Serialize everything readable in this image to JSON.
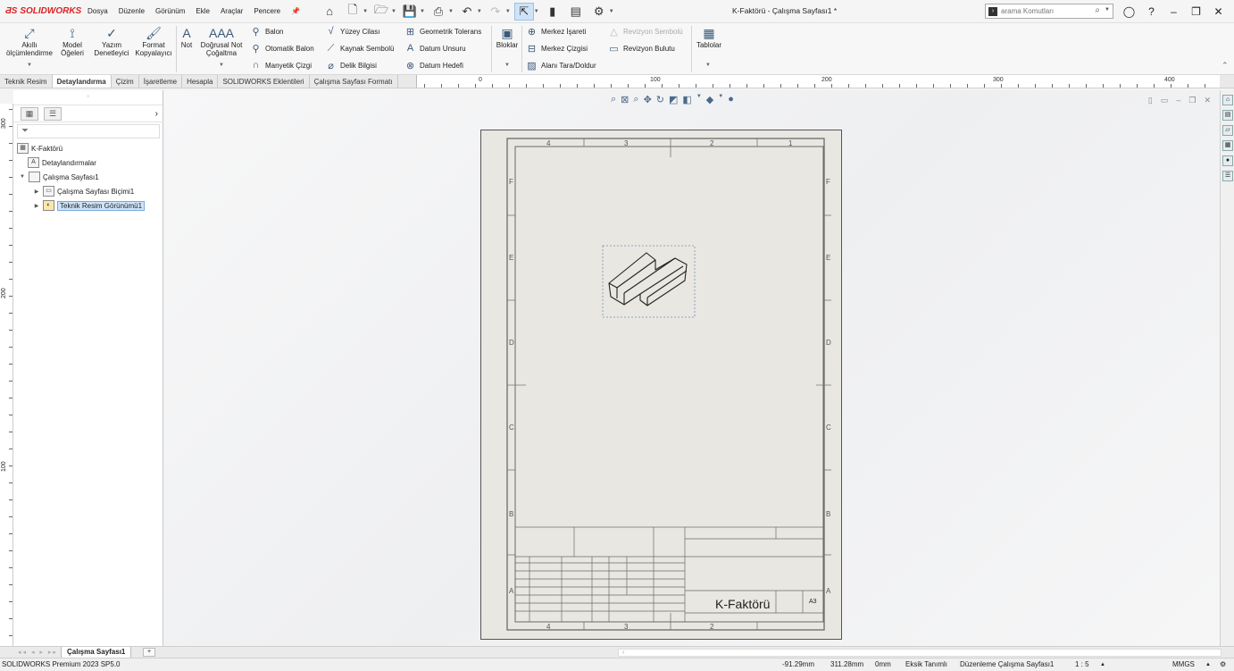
{
  "app": {
    "logo_text": "SOLIDWORKS",
    "window_title": "K-Faktörü - Çalışma Sayfası1 *"
  },
  "menu": [
    "Dosya",
    "Düzenle",
    "Görünüm",
    "Ekle",
    "Araçlar",
    "Pencere"
  ],
  "search": {
    "placeholder": "arama Komutları"
  },
  "ribbon": {
    "big_buttons": [
      {
        "label": "Akıllı ölçümlendirme",
        "icon": "smart-dimension-icon"
      },
      {
        "label": "Model Öğeleri",
        "icon": "model-items-icon"
      },
      {
        "label": "Yazım Denetleyici",
        "icon": "spell-checker-icon"
      },
      {
        "label": "Format Kopyalayıcı",
        "icon": "format-painter-icon"
      },
      {
        "label": "Not",
        "icon": "note-icon"
      },
      {
        "label": "Doğrusal Not Çoğaltma",
        "icon": "linear-note-pattern-icon"
      }
    ],
    "col1": [
      "Balon",
      "Otomatik Balon",
      "Manyetik Çizgi"
    ],
    "col2": [
      "Yüzey Cilası",
      "Kaynak Sembolü",
      "Delik Bilgisi"
    ],
    "col3": [
      "Geometrik Tolerans",
      "Datum Unsuru",
      "Datum Hedefi"
    ],
    "blocks": "Bloklar",
    "col4": [
      "Merkez İşareti",
      "Merkez Çizgisi",
      "Alanı Tara/Doldur"
    ],
    "col5": [
      "Revizyon Sembolü",
      "Revizyon Bulutu"
    ],
    "tables": "Tablolar"
  },
  "tabs": [
    {
      "label": "Teknik Resim",
      "active": false
    },
    {
      "label": "Detaylandırma",
      "active": true
    },
    {
      "label": "Çizim",
      "active": false
    },
    {
      "label": "İşaretleme",
      "active": false
    },
    {
      "label": "Hesapla",
      "active": false
    },
    {
      "label": "SOLIDWORKS Eklentileri",
      "active": false
    },
    {
      "label": "Çalışma Sayfası Formatı",
      "active": false
    }
  ],
  "hruler_labels": [
    "0",
    "100",
    "200",
    "300",
    "400"
  ],
  "vruler_labels": [
    "300",
    "200",
    "100"
  ],
  "tree": {
    "root": "K-Faktörü",
    "annotations": "Detaylandırmalar",
    "sheet": "Çalışma Sayfası1",
    "sheet_format": "Çalışma Sayfası Biçimi1",
    "drawing_view": "Teknik Resim Görünümü1"
  },
  "drawing": {
    "col_labels": [
      "4",
      "3",
      "2",
      "1"
    ],
    "row_labels": [
      "F",
      "E",
      "D",
      "C",
      "B",
      "A"
    ],
    "title": "K-Faktörü",
    "sheet_size": "A3"
  },
  "sheet_tab": "Çalışma Sayfası1",
  "status": {
    "product": "SOLIDWORKS Premium 2023 SP5.0",
    "x": "-91.29mm",
    "y": "311.28mm",
    "z": "0mm",
    "state": "Eksik Tanımlı",
    "mode": "Düzenleme Çalışma Sayfası1",
    "scale": "1 : 5",
    "units": "MMGS"
  }
}
